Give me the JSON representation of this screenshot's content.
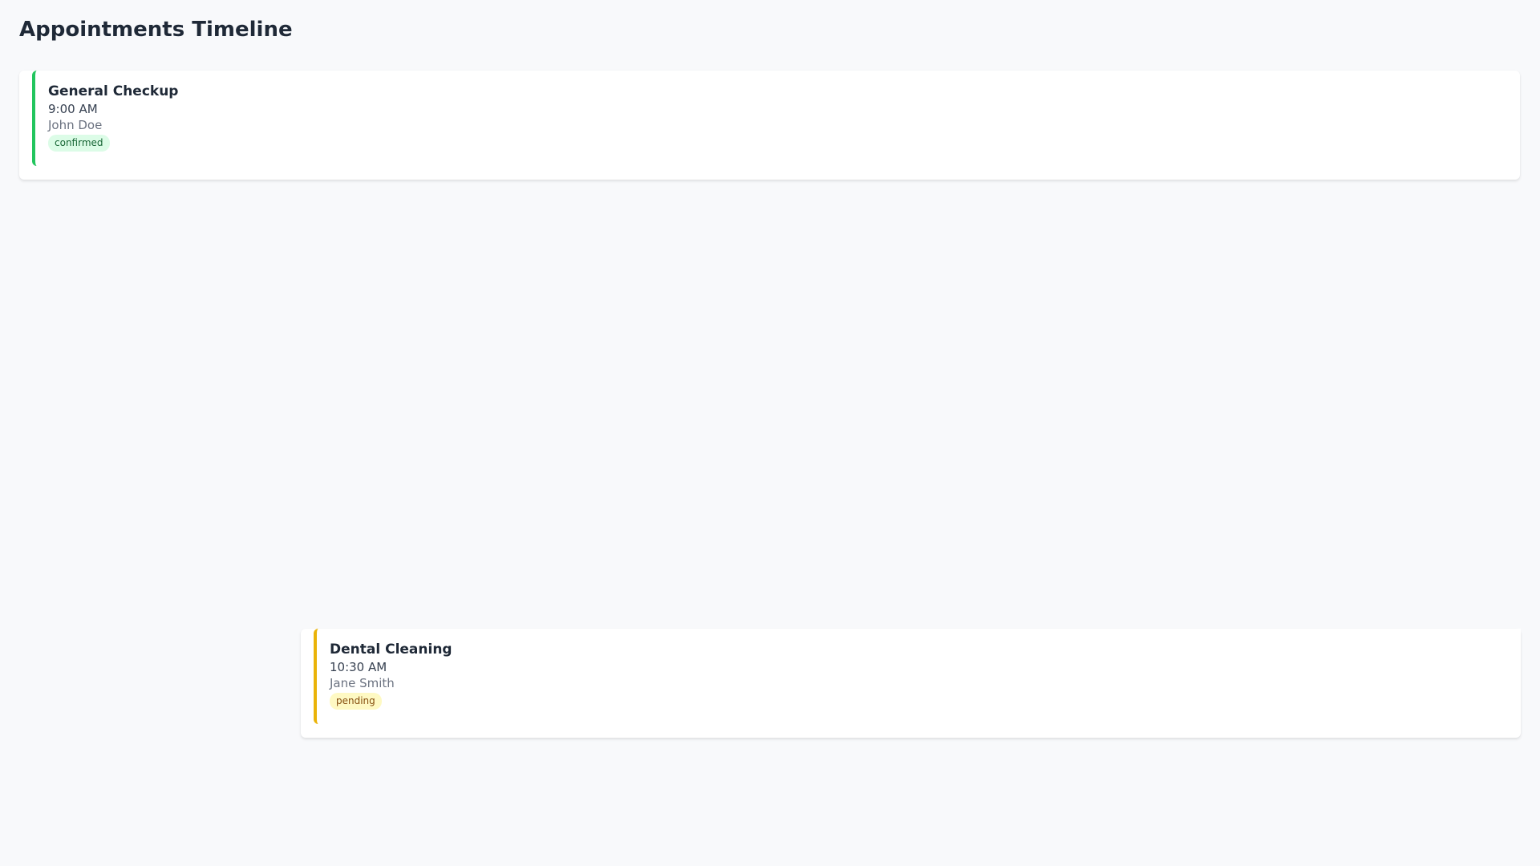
{
  "page": {
    "title": "Appointments Timeline"
  },
  "appointments": [
    {
      "title": "General Checkup",
      "time": "9:00 AM",
      "patient": "John Doe",
      "status": "confirmed",
      "accent_color": "#22c55e"
    },
    {
      "title": "Dental Cleaning",
      "time": "10:30 AM",
      "patient": "Jane Smith",
      "status": "pending",
      "accent_color": "#eab308"
    }
  ]
}
